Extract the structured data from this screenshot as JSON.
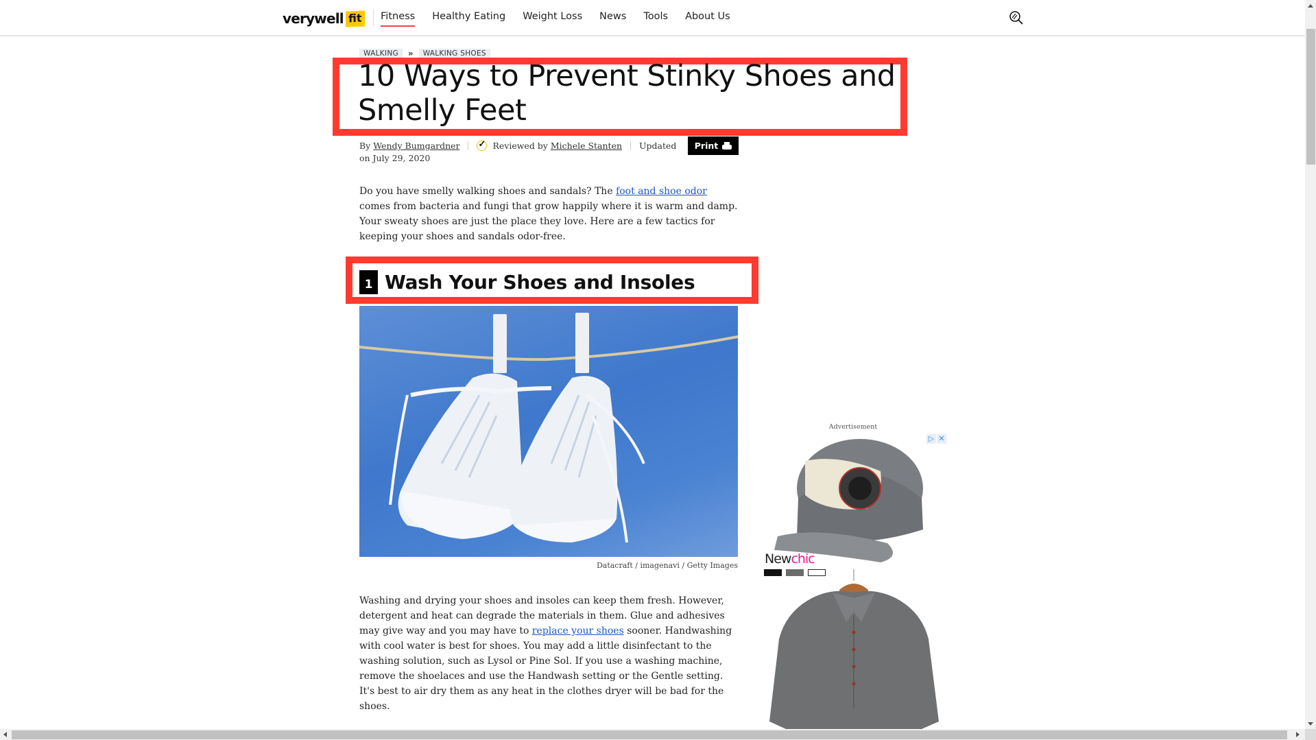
{
  "header": {
    "logo_main": "verywell",
    "logo_fit": "fit",
    "nav": [
      {
        "label": "Fitness",
        "active": true
      },
      {
        "label": "Healthy Eating",
        "active": false
      },
      {
        "label": "Weight Loss",
        "active": false
      },
      {
        "label": "News",
        "active": false
      },
      {
        "label": "Tools",
        "active": false
      },
      {
        "label": "About Us",
        "active": false
      }
    ],
    "search_icon": "search-icon",
    "accent_color": "#e8483a",
    "logo_fit_color": "#fcc900"
  },
  "breadcrumb": [
    "WALKING",
    "WALKING SHOES"
  ],
  "breadcrumb_separator": "»",
  "article": {
    "title": "10 Ways to Prevent Stinky Shoes and Smelly Feet",
    "byline": {
      "by": "By",
      "author": "Wendy Bumgardner",
      "reviewed_by": "Reviewed by",
      "reviewer": "Michele Stanten",
      "updated": "Updated",
      "date": "on July 29, 2020"
    },
    "print_label": "Print",
    "intro": {
      "before": "Do you have smelly walking shoes and sandals? The ",
      "link": "foot and shoe odor",
      "after": " comes from bacteria and fungi that grow happily where it is warm and damp. Your sweaty shoes are just the place they love. Here are a few tactics for keeping your shoes and sandals odor-free."
    },
    "section": {
      "number": "1",
      "heading": "Wash Your Shoes and Insoles",
      "image_alt": "White sneakers hanging from a clothesline against blue sky",
      "caption": "Datacraft / imagenavi / Getty Images",
      "body": {
        "before": "Washing and drying your shoes and insoles can keep them fresh. However, detergent and heat can degrade the materials in them. Glue and adhesives may give way and you may have to ",
        "link": "replace your shoes",
        "after": " sooner. Handwashing with cool water is best for shoes. You may add a little disinfectant to the washing solution, such as Lysol or Pine Sol. If you use a washing machine, remove the shoelaces and use the Handwash setting or the Gentle setting. It's best to air dry them as any heat in the clothes dryer will be bad for the shoes."
      }
    },
    "highlight_color": "#ff3b30",
    "link_color": "#1a55c4"
  },
  "ad": {
    "label": "Advertisement",
    "brand_part1": "New",
    "brand_part2": "chic",
    "adchoices_icon": "▷",
    "close_icon": "✕",
    "swatch_colors": [
      "#111111",
      "#6b6b6b",
      "#ffffff"
    ]
  }
}
